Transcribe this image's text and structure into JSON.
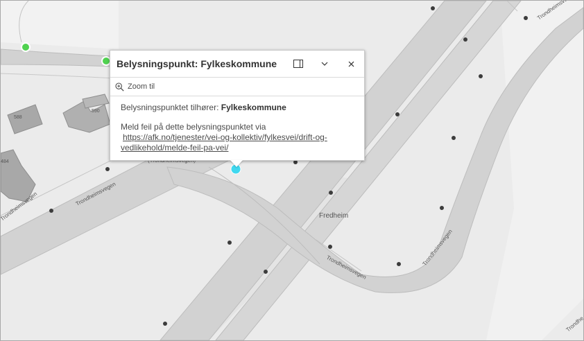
{
  "map": {
    "house_numbers": [
      "588",
      "590",
      "484"
    ],
    "road_labels": {
      "trondheimsvegen_1": "Trondheimsvegen",
      "trondheimsvegen_2": "Trondheimsvegen",
      "trondheimsvegen_3": "Trondheimsvegen",
      "trondheimsvegen_4": "Trondheimsvegen",
      "trondheimsvegen_5": "Trondheimsvegen",
      "trondheimsvegen_6": "Trondhe"
    },
    "place_label": "Fredheim",
    "partial_label": "(Trondheimsvegen)",
    "colors": {
      "background": "#ebebeb",
      "road": "#d2d2d2",
      "road_edge": "#bcbcbc",
      "building": "#a8a8a8",
      "light_point": "#3c3c3c",
      "green_marker": "#50d250",
      "selected_marker": "#40d8ef"
    }
  },
  "popup": {
    "title": "Belysningspunkt: Fylkeskommune",
    "icons": {
      "dock": "dock-icon",
      "collapse": "chevron-down-icon",
      "close": "close-icon",
      "zoom": "zoom-in-icon"
    },
    "zoom_label": "Zoom til",
    "owner_prefix": "Belysningspunktet tilhører: ",
    "owner_value": "Fylkeskommune",
    "report_text": "Meld feil på dette belysningspunktet via",
    "report_link_line1": "https://afk.no/tjenester/vei-og-kollektiv/fylkesvei/drift-og-",
    "report_link_line2": "vedlikehold/melde-feil-pa-vei/"
  }
}
